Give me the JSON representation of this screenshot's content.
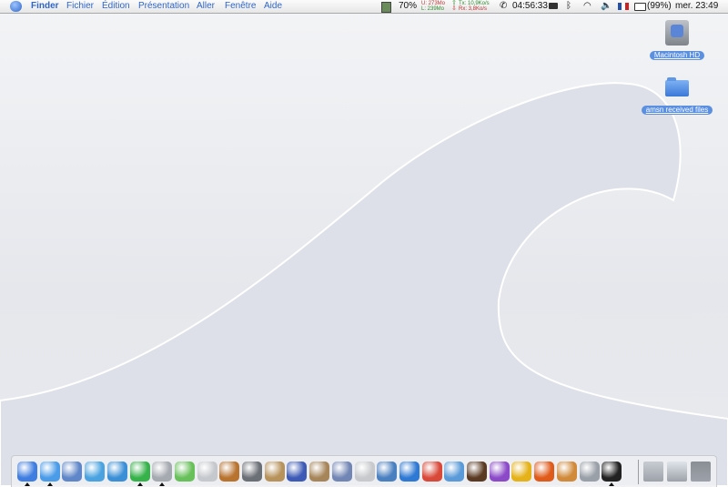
{
  "menubar": {
    "app_name": "Finder",
    "menus": [
      "Fichier",
      "Édition",
      "Présentation",
      "Aller",
      "Fenêtre",
      "Aide"
    ],
    "status": {
      "cpu_percent": "70%",
      "mem_used": "U:  273Mo",
      "mem_free": "L:  239Mo",
      "net_tx": "Tx:   10,9Ko/s",
      "net_rx": "Rx:    3,8Ko/s",
      "time": "04:56:33",
      "battery": "(99%)",
      "clock": "mer. 23:49"
    }
  },
  "desktop": {
    "items": [
      {
        "label": "Macintosh HD",
        "icon": "hard-drive-icon"
      },
      {
        "label": "amsn received files",
        "icon": "folder-icon"
      }
    ]
  },
  "dock": {
    "apps": [
      {
        "icon": "finder-icon",
        "color": "#3f7de0",
        "running": true
      },
      {
        "icon": "safari-icon",
        "color": "#4a9be8",
        "running": true
      },
      {
        "icon": "preview-icon",
        "color": "#5f86c8",
        "running": false
      },
      {
        "icon": "messenger-icon",
        "color": "#4aa3e0",
        "running": false
      },
      {
        "icon": "ichat-icon",
        "color": "#3b8fd6",
        "running": false
      },
      {
        "icon": "skype-icon",
        "color": "#35b24a",
        "running": true
      },
      {
        "icon": "system-prefs-icon",
        "color": "#a5a9b0",
        "running": true
      },
      {
        "icon": "itunes-icon",
        "color": "#68c05a",
        "running": false
      },
      {
        "icon": "mail-stamp-icon",
        "color": "#c5c8cc",
        "running": false
      },
      {
        "icon": "garageband-icon",
        "color": "#b8732f",
        "running": false
      },
      {
        "icon": "sherlock-icon",
        "color": "#6b6f76",
        "running": false
      },
      {
        "icon": "installer-icon",
        "color": "#b7925a",
        "running": false
      },
      {
        "icon": "imovie-icon",
        "color": "#3d5bb6",
        "running": false
      },
      {
        "icon": "package-icon",
        "color": "#a6855a",
        "running": false
      },
      {
        "icon": "photos-icon",
        "color": "#7286b5",
        "running": false
      },
      {
        "icon": "ipod-icon",
        "color": "#c7c9cc",
        "running": false
      },
      {
        "icon": "iphoto-icon",
        "color": "#4a7fc0",
        "running": false
      },
      {
        "icon": "quicktime-icon",
        "color": "#2e79d4",
        "running": false
      },
      {
        "icon": "ical-icon",
        "color": "#d9493a",
        "running": false
      },
      {
        "icon": "iweb-icon",
        "color": "#5a9ad8",
        "running": false
      },
      {
        "icon": "spider-icon",
        "color": "#5a3a22",
        "running": false
      },
      {
        "icon": "yahoo-icon",
        "color": "#8c4ac8",
        "running": false
      },
      {
        "icon": "road-sign-icon",
        "color": "#e5b21a",
        "running": false
      },
      {
        "icon": "flame-icon",
        "color": "#e05a1a",
        "running": false
      },
      {
        "icon": "game-icon",
        "color": "#d08a3a",
        "running": false
      },
      {
        "icon": "disk-utility-icon",
        "color": "#9aa0a8",
        "running": false
      },
      {
        "icon": "terminal-icon",
        "color": "#222222",
        "running": true
      }
    ],
    "docs": [
      {
        "icon": "window-thumbnail-icon",
        "color": "#c8ccd2"
      },
      {
        "icon": "browser-thumbnail-icon",
        "color": "#dfe4ea"
      },
      {
        "icon": "trash-icon",
        "color": "#8a8e94"
      }
    ]
  }
}
